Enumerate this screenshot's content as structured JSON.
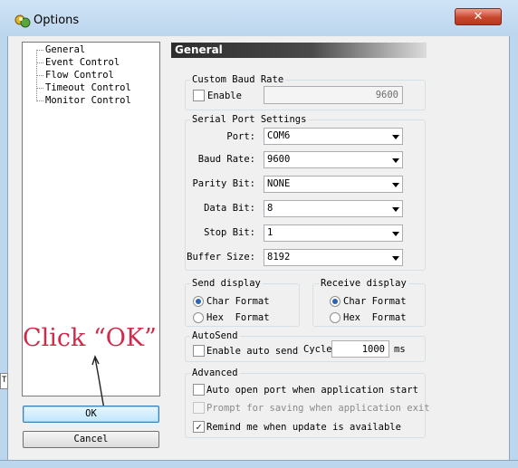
{
  "window": {
    "title": "Options",
    "close_label": "✕"
  },
  "tree": {
    "items": [
      "General",
      "Event Control",
      "Flow Control",
      "Timeout Control",
      "Monitor Control"
    ]
  },
  "buttons": {
    "ok": "OK",
    "cancel": "Cancel"
  },
  "panel": {
    "title": "General"
  },
  "custom_baud": {
    "title": "Custom Baud Rate",
    "enable_label": "Enable",
    "enable_checked": false,
    "value": "9600"
  },
  "serial": {
    "title": "Serial Port Settings",
    "port": {
      "label": "Port:",
      "value": "COM6"
    },
    "baud": {
      "label": "Baud Rate:",
      "value": "9600"
    },
    "parity": {
      "label": "Parity Bit:",
      "value": "NONE"
    },
    "data": {
      "label": "Data Bit:",
      "value": "8"
    },
    "stop": {
      "label": "Stop Bit:",
      "value": "1"
    },
    "buffer": {
      "label": "Buffer Size:",
      "value": "8192"
    }
  },
  "send_display": {
    "title": "Send display",
    "options": [
      "Char Format",
      "Hex  Format"
    ],
    "selected": "Char Format"
  },
  "receive_display": {
    "title": "Receive display",
    "options": [
      "Char Format",
      "Hex  Format"
    ],
    "selected": "Char Format"
  },
  "autosend": {
    "title": "AutoSend",
    "enable_label": "Enable auto send",
    "enable_checked": false,
    "cycle_label": "Cycle",
    "cycle_value": "1000",
    "unit": "ms"
  },
  "advanced": {
    "title": "Advanced",
    "auto_open": {
      "label": "Auto open port when application start",
      "checked": false
    },
    "prompt_save": {
      "label": "Prompt for saving when application exit",
      "checked": false,
      "disabled": true
    },
    "remind_update": {
      "label": "Remind me when update is available",
      "checked": true
    }
  },
  "annotation": {
    "text": "Click “OK”",
    "color": "#d02a4a"
  }
}
